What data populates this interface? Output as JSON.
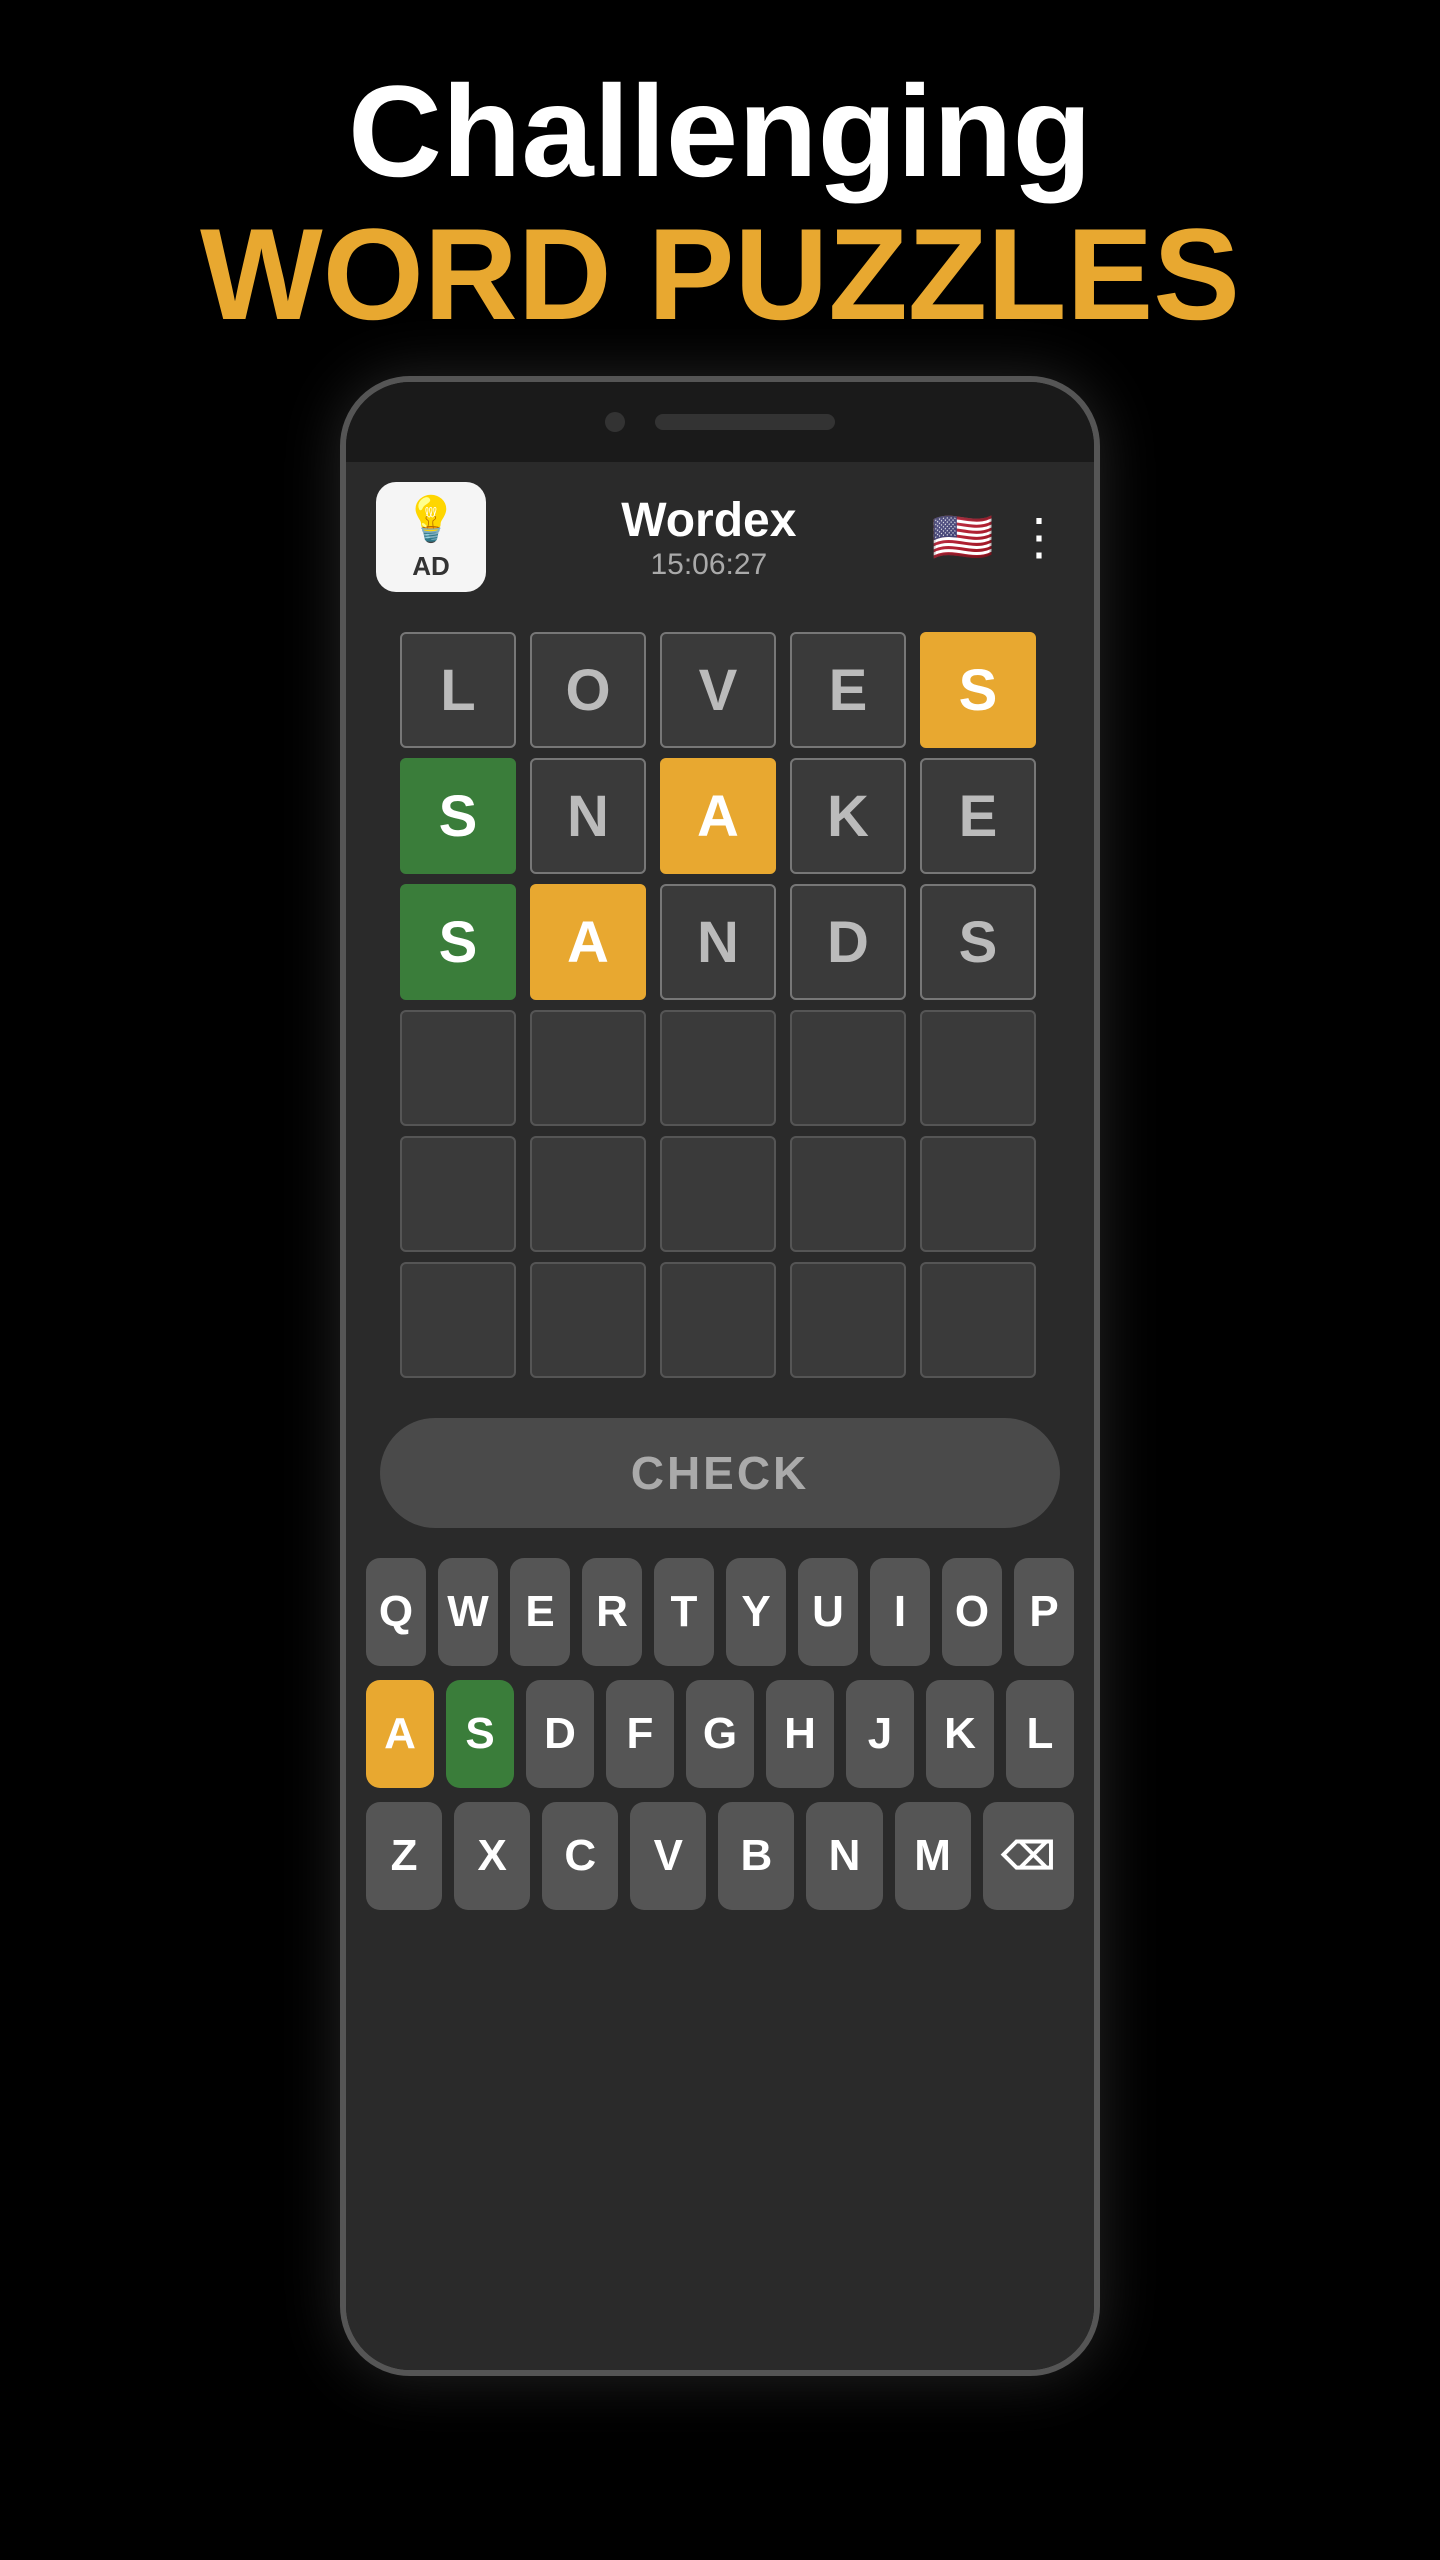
{
  "header": {
    "line1": "Challenging",
    "line2": "WORD PUZZLES"
  },
  "app": {
    "title": "Wordex",
    "timer": "15:06:27",
    "ad_label": "AD",
    "bulb_icon": "💡"
  },
  "check_button": "CHECK",
  "grid": {
    "rows": [
      [
        {
          "letter": "L",
          "state": "filled"
        },
        {
          "letter": "O",
          "state": "filled"
        },
        {
          "letter": "V",
          "state": "filled"
        },
        {
          "letter": "E",
          "state": "filled"
        },
        {
          "letter": "S",
          "state": "orange"
        }
      ],
      [
        {
          "letter": "S",
          "state": "green"
        },
        {
          "letter": "N",
          "state": "filled"
        },
        {
          "letter": "A",
          "state": "orange"
        },
        {
          "letter": "K",
          "state": "filled"
        },
        {
          "letter": "E",
          "state": "filled"
        }
      ],
      [
        {
          "letter": "S",
          "state": "green"
        },
        {
          "letter": "A",
          "state": "orange"
        },
        {
          "letter": "N",
          "state": "filled"
        },
        {
          "letter": "D",
          "state": "filled"
        },
        {
          "letter": "S",
          "state": "filled"
        }
      ],
      [
        {
          "letter": "",
          "state": "empty"
        },
        {
          "letter": "",
          "state": "empty"
        },
        {
          "letter": "",
          "state": "empty"
        },
        {
          "letter": "",
          "state": "empty"
        },
        {
          "letter": "",
          "state": "empty"
        }
      ],
      [
        {
          "letter": "",
          "state": "empty"
        },
        {
          "letter": "",
          "state": "empty"
        },
        {
          "letter": "",
          "state": "empty"
        },
        {
          "letter": "",
          "state": "empty"
        },
        {
          "letter": "",
          "state": "empty"
        }
      ],
      [
        {
          "letter": "",
          "state": "empty"
        },
        {
          "letter": "",
          "state": "empty"
        },
        {
          "letter": "",
          "state": "empty"
        },
        {
          "letter": "",
          "state": "empty"
        },
        {
          "letter": "",
          "state": "empty"
        }
      ]
    ]
  },
  "keyboard": {
    "row1": [
      {
        "letter": "Q",
        "state": "normal"
      },
      {
        "letter": "W",
        "state": "normal"
      },
      {
        "letter": "E",
        "state": "normal"
      },
      {
        "letter": "R",
        "state": "normal"
      },
      {
        "letter": "T",
        "state": "normal"
      },
      {
        "letter": "Y",
        "state": "normal"
      },
      {
        "letter": "U",
        "state": "normal"
      },
      {
        "letter": "I",
        "state": "normal"
      },
      {
        "letter": "O",
        "state": "normal"
      },
      {
        "letter": "P",
        "state": "normal"
      }
    ],
    "row2": [
      {
        "letter": "A",
        "state": "orange"
      },
      {
        "letter": "S",
        "state": "green"
      },
      {
        "letter": "D",
        "state": "normal"
      },
      {
        "letter": "F",
        "state": "normal"
      },
      {
        "letter": "G",
        "state": "normal"
      },
      {
        "letter": "H",
        "state": "normal"
      },
      {
        "letter": "J",
        "state": "normal"
      },
      {
        "letter": "K",
        "state": "normal"
      },
      {
        "letter": "L",
        "state": "normal"
      }
    ],
    "row3": [
      {
        "letter": "Z",
        "state": "normal"
      },
      {
        "letter": "X",
        "state": "normal"
      },
      {
        "letter": "C",
        "state": "normal"
      },
      {
        "letter": "V",
        "state": "normal"
      },
      {
        "letter": "B",
        "state": "normal"
      },
      {
        "letter": "N",
        "state": "normal"
      },
      {
        "letter": "M",
        "state": "normal"
      },
      {
        "letter": "⌫",
        "state": "backspace"
      }
    ]
  }
}
